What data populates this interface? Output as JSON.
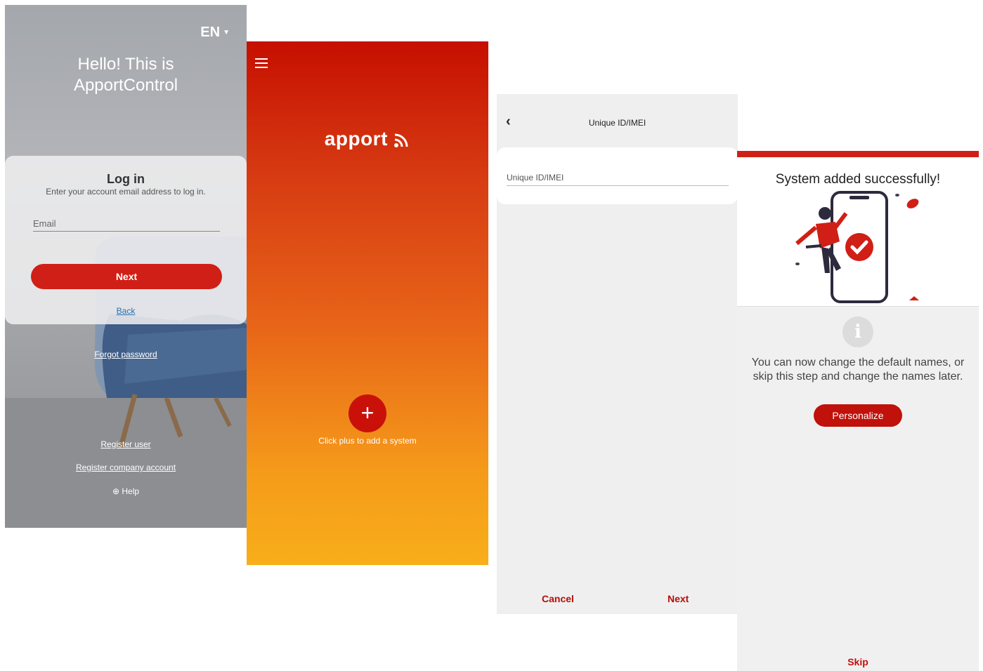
{
  "login": {
    "language": "EN",
    "greeting_line1": "Hello! This is",
    "greeting_line2": "ApportControl",
    "title": "Log in",
    "subtitle": "Enter your account email address to log in.",
    "email_placeholder": "Email",
    "next_label": "Next",
    "back_label": "Back",
    "forgot_label": "Forgot password",
    "register_user_label": "Register user",
    "register_company_label": "Register company account",
    "help_label": "Help"
  },
  "home": {
    "logo_text": "apport",
    "add_hint": "Click plus to add a system",
    "plus_symbol": "+"
  },
  "unique_id": {
    "header_title": "Unique ID/IMEI",
    "field_placeholder": "Unique ID/IMEI",
    "cancel_label": "Cancel",
    "next_label": "Next"
  },
  "success": {
    "title": "System added successfully!",
    "message": "You can now change the default names, or skip this step and change the names later.",
    "personalize_label": "Personalize",
    "skip_label": "Skip",
    "info_symbol": "i"
  },
  "colors": {
    "brand_red": "#d01f16",
    "gradient_top": "#c60f00",
    "gradient_bottom": "#f8ae1a"
  }
}
